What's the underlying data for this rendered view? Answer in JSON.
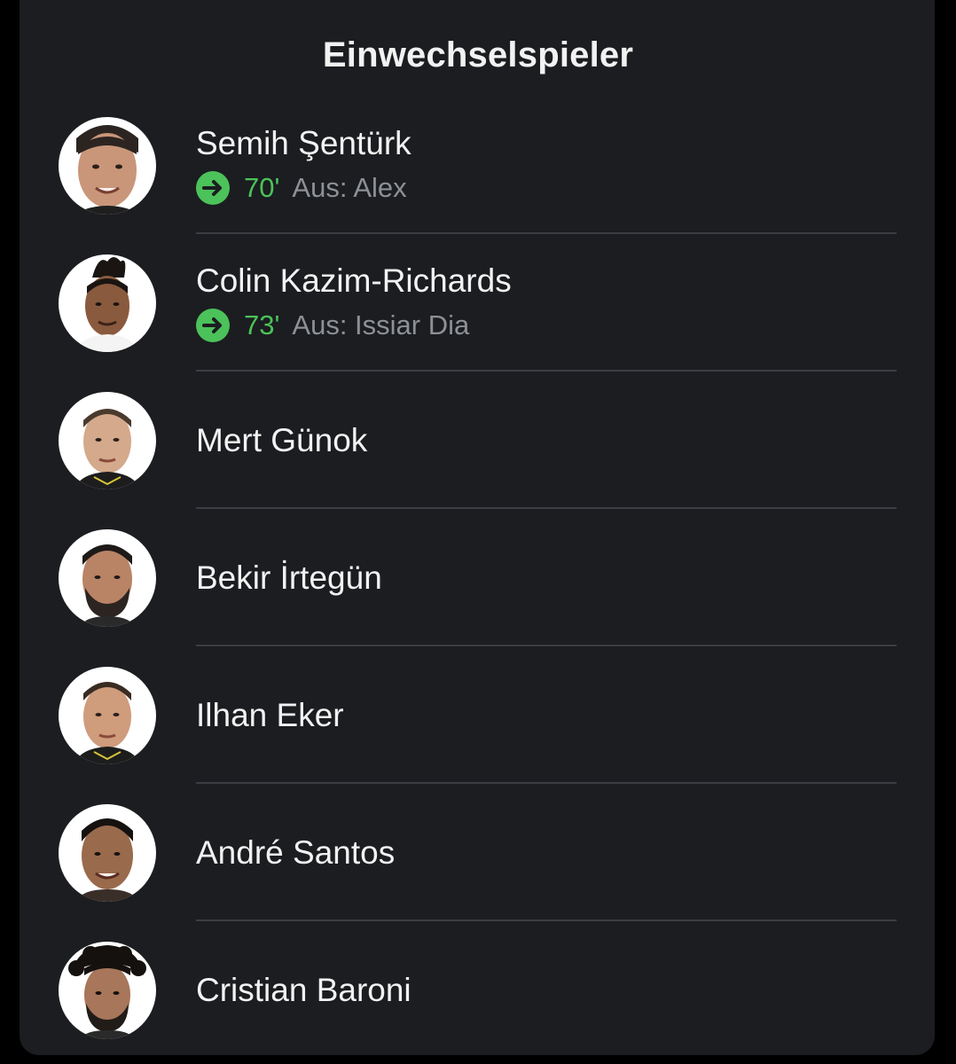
{
  "section_title": "Einwechselspieler",
  "colors": {
    "background": "#1b1d20",
    "text": "#f2f2f2",
    "sub_minute": "#4cc25a",
    "sub_out": "#8d9095",
    "divider": "#3a3d42"
  },
  "players": [
    {
      "name": "Semih Şentürk",
      "photo_icon": "player-photo",
      "substitution": {
        "icon": "arrow-right-circle-icon",
        "minute": "70'",
        "out": "Aus: Alex"
      }
    },
    {
      "name": "Colin Kazim-Richards",
      "photo_icon": "player-photo",
      "substitution": {
        "icon": "arrow-right-circle-icon",
        "minute": "73'",
        "out": "Aus: Issiar Dia"
      }
    },
    {
      "name": "Mert Günok",
      "photo_icon": "player-photo"
    },
    {
      "name": "Bekir İrtegün",
      "photo_icon": "player-photo"
    },
    {
      "name": "Ilhan Eker",
      "photo_icon": "player-photo"
    },
    {
      "name": "André Santos",
      "photo_icon": "player-photo"
    },
    {
      "name": "Cristian Baroni",
      "photo_icon": "player-photo"
    }
  ]
}
